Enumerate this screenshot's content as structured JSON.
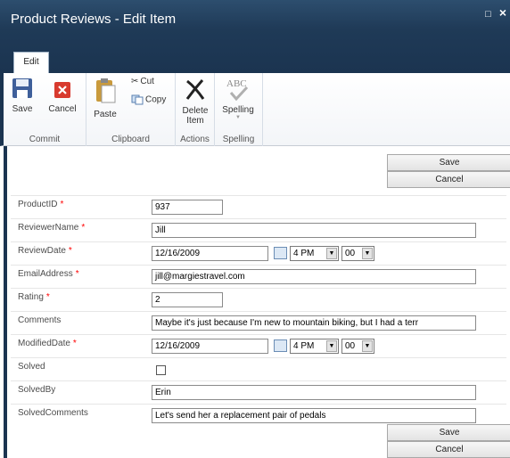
{
  "dialog": {
    "title": "Product Reviews - Edit Item",
    "maximize_glyph": "□",
    "close_glyph": "×"
  },
  "ribbon": {
    "tab_label": "Edit",
    "groups": {
      "commit": "Commit",
      "clipboard": "Clipboard",
      "actions": "Actions",
      "spelling": "Spelling"
    },
    "buttons": {
      "save": "Save",
      "cancel": "Cancel",
      "paste": "Paste",
      "cut": "Cut",
      "copy": "Copy",
      "delete_line1": "Delete",
      "delete_line2": "Item",
      "spelling": "Spelling",
      "spelling_icon_text": "ABC"
    }
  },
  "form": {
    "save_label": "Save",
    "cancel_label": "Cancel",
    "required_marker": "*",
    "fields": {
      "product_id": {
        "label": "ProductID",
        "value": "937"
      },
      "reviewer_name": {
        "label": "ReviewerName",
        "value": "Jill"
      },
      "review_date": {
        "label": "ReviewDate",
        "date": "12/16/2009",
        "hour": "4 PM",
        "minute": "00"
      },
      "email": {
        "label": "EmailAddress",
        "value": "jill@margiestravel.com"
      },
      "rating": {
        "label": "Rating",
        "value": "2"
      },
      "comments": {
        "label": "Comments",
        "value": "Maybe it's just because I'm new to mountain biking, but I had a terr"
      },
      "modified_date": {
        "label": "ModifiedDate",
        "date": "12/16/2009",
        "hour": "4 PM",
        "minute": "00"
      },
      "solved": {
        "label": "Solved",
        "checked": false
      },
      "solved_by": {
        "label": "SolvedBy",
        "value": "Erin"
      },
      "solved_comments": {
        "label": "SolvedComments",
        "value": "Let's send her a replacement pair of pedals"
      }
    }
  },
  "colors": {
    "title_bar": "#1f3a57",
    "required": "#ff0000"
  }
}
